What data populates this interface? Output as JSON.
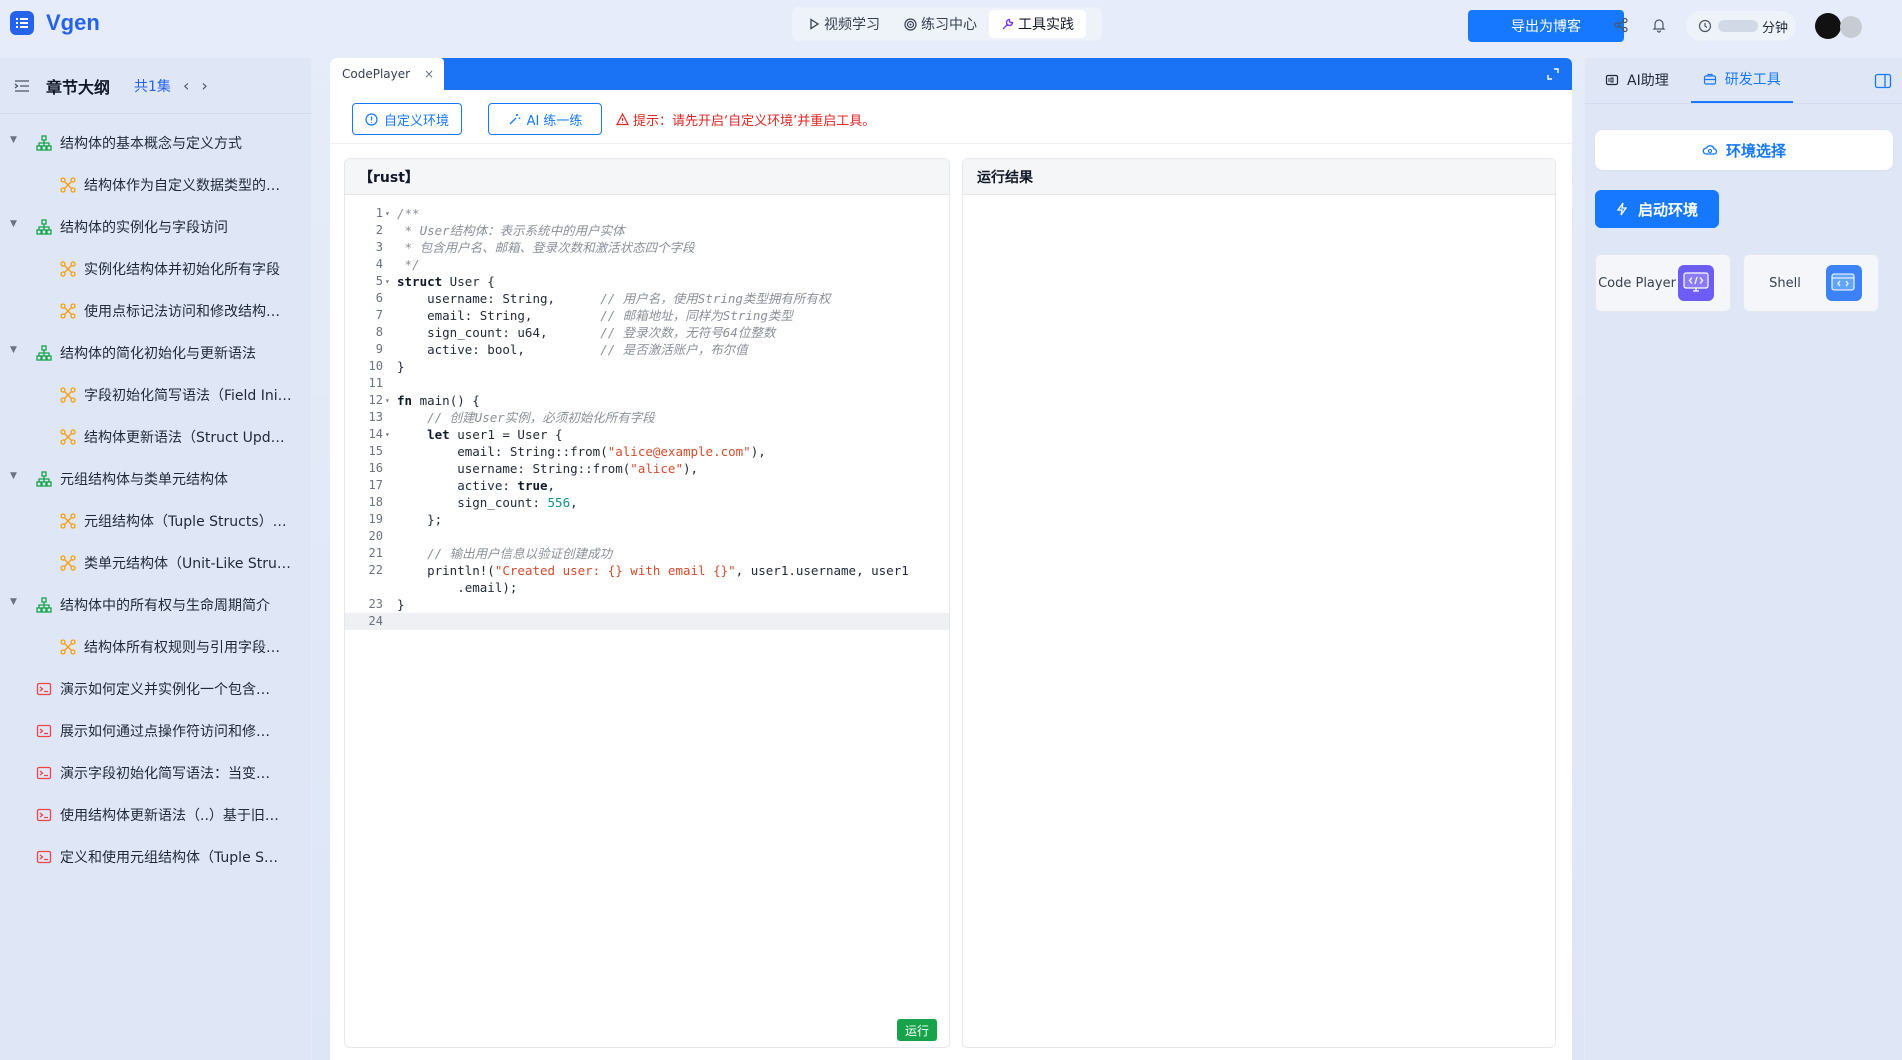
{
  "app": {
    "name": "Vgen"
  },
  "nav": {
    "tabs": [
      {
        "label": "视频学习"
      },
      {
        "label": "练习中心"
      },
      {
        "label": "工具实践"
      }
    ]
  },
  "header": {
    "export_label": "导出为博客",
    "timer_suffix": "分钟"
  },
  "sidebar": {
    "title": "章节大纲",
    "count": "共1集",
    "items": [
      {
        "label": "结构体的基本概念与定义方式",
        "level": 1
      },
      {
        "label": "结构体作为自定义数据类型的用...",
        "level": 2
      },
      {
        "label": "结构体的实例化与字段访问",
        "level": 1
      },
      {
        "label": "实例化结构体并初始化所有字段",
        "level": 2
      },
      {
        "label": "使用点标记法访问和修改结构体...",
        "level": 2
      },
      {
        "label": "结构体的简化初始化与更新语法",
        "level": 1
      },
      {
        "label": "字段初始化简写语法（Field Init ...",
        "level": 2
      },
      {
        "label": "结构体更新语法（Struct Update...",
        "level": 2
      },
      {
        "label": "元组结构体与类单元结构体",
        "level": 1
      },
      {
        "label": "元组结构体（Tuple Structs）的...",
        "level": 2
      },
      {
        "label": "类单元结构体（Unit-Like Struct...",
        "level": 2
      },
      {
        "label": "结构体中的所有权与生命周期简介",
        "level": 1
      },
      {
        "label": "结构体所有权规则与引用字段限...",
        "level": 2
      },
      {
        "label": "演示如何定义并实例化一个包含基...",
        "level": 3
      },
      {
        "label": "展示如何通过点操作符访问和修改...",
        "level": 3
      },
      {
        "label": "演示字段初始化简写语法：当变量...",
        "level": 3
      },
      {
        "label": "使用结构体更新语法（..）基于旧实...",
        "level": 3
      },
      {
        "label": "定义和使用元组结构体（Tuple Stru...",
        "level": 3
      }
    ]
  },
  "editor": {
    "tab_label": "CodePlayer",
    "custom_env_label": "自定义环境",
    "ai_practice_label": "AI 练一练",
    "warning": "提示：请先开启‘自定义环境’并重启工具。",
    "code_title": "【rust】",
    "result_title": "运行结果",
    "run_label": "运行",
    "lines": [
      {
        "n": "1",
        "fold": true,
        "text": "/**",
        "kind": "comment"
      },
      {
        "n": "2",
        "text": " * User结构体：表示系统中的用户实体",
        "kind": "comment"
      },
      {
        "n": "3",
        "text": " * 包含用户名、邮箱、登录次数和激活状态四个字段",
        "kind": "comment"
      },
      {
        "n": "4",
        "text": " */",
        "kind": "comment"
      },
      {
        "n": "5",
        "fold": true,
        "text": "struct User {",
        "kind": "code"
      },
      {
        "n": "6",
        "text": "    username: String,      // 用户名，使用String类型拥有所有权",
        "kind": "code"
      },
      {
        "n": "7",
        "text": "    email: String,         // 邮箱地址，同样为String类型",
        "kind": "code"
      },
      {
        "n": "8",
        "text": "    sign_count: u64,       // 登录次数，无符号64位整数",
        "kind": "code"
      },
      {
        "n": "9",
        "text": "    active: bool,          // 是否激活账户，布尔值",
        "kind": "code"
      },
      {
        "n": "10",
        "text": "}",
        "kind": "code"
      },
      {
        "n": "11",
        "text": "",
        "kind": "code"
      },
      {
        "n": "12",
        "fold": true,
        "text": "fn main() {",
        "kind": "code"
      },
      {
        "n": "13",
        "text": "    // 创建User实例，必须初始化所有字段",
        "kind": "comment"
      },
      {
        "n": "14",
        "fold": true,
        "text": "    let user1 = User {",
        "kind": "code"
      },
      {
        "n": "15",
        "text": "        email: String::from(\"alice@example.com\"),",
        "kind": "code"
      },
      {
        "n": "16",
        "text": "        username: String::from(\"alice\"),",
        "kind": "code"
      },
      {
        "n": "17",
        "text": "        active: true,",
        "kind": "code"
      },
      {
        "n": "18",
        "text": "        sign_count: 556,",
        "kind": "code"
      },
      {
        "n": "19",
        "text": "    };",
        "kind": "code"
      },
      {
        "n": "20",
        "text": "",
        "kind": "code"
      },
      {
        "n": "21",
        "text": "    // 输出用户信息以验证创建成功",
        "kind": "comment"
      },
      {
        "n": "22",
        "text": "    println!(\"Created user: {} with email {}\", user1.username, user1",
        "kind": "code"
      },
      {
        "n": "",
        "text": "        .email);",
        "kind": "code"
      },
      {
        "n": "23",
        "text": "}",
        "kind": "code"
      },
      {
        "n": "24",
        "text": "",
        "kind": "code",
        "current": true
      }
    ]
  },
  "right_panel": {
    "tabs": [
      {
        "label": "AI助理"
      },
      {
        "label": "研发工具"
      }
    ],
    "env_select_label": "环境选择",
    "start_label": "启动环境",
    "tools": [
      {
        "label": "Code Player"
      },
      {
        "label": "Shell"
      }
    ]
  },
  "colors": {
    "accent": "#1677ff",
    "brand": "#2563eb",
    "warning": "#e02424",
    "run": "#16a34a",
    "comment": "#8a8f98",
    "string": "#d14b2f",
    "number": "#0d9488"
  }
}
